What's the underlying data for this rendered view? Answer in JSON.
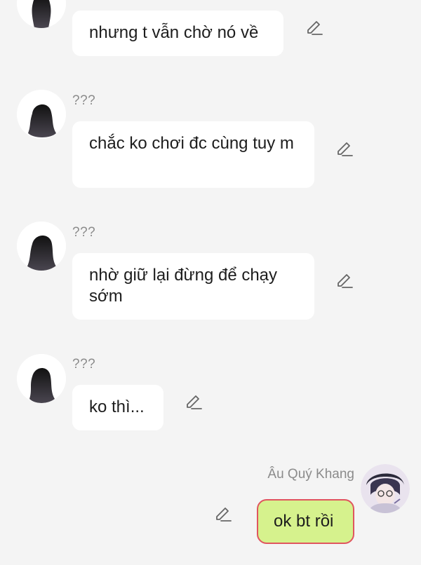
{
  "messages": [
    {
      "sender": "",
      "text": "nhưng t vẫn chờ nó về"
    },
    {
      "sender": "???",
      "text": "chắc ko chơi đc cùng tuy m"
    },
    {
      "sender": "???",
      "text": "nhờ giữ lại đừng để chạy sớm"
    },
    {
      "sender": "???",
      "text": "ko thì..."
    }
  ],
  "me": {
    "name": "Âu Quý Khang",
    "text": "ok bt rồi"
  },
  "colors": {
    "background": "#f4f4f4",
    "bubble": "#ffffff",
    "my_bubble": "#d6f28d",
    "my_bubble_border": "#e0555f",
    "sender_text": "#8b8b8b"
  },
  "icons": [
    "silhouette-avatar-icon",
    "edit-pencil-icon",
    "anime-avatar-icon"
  ]
}
